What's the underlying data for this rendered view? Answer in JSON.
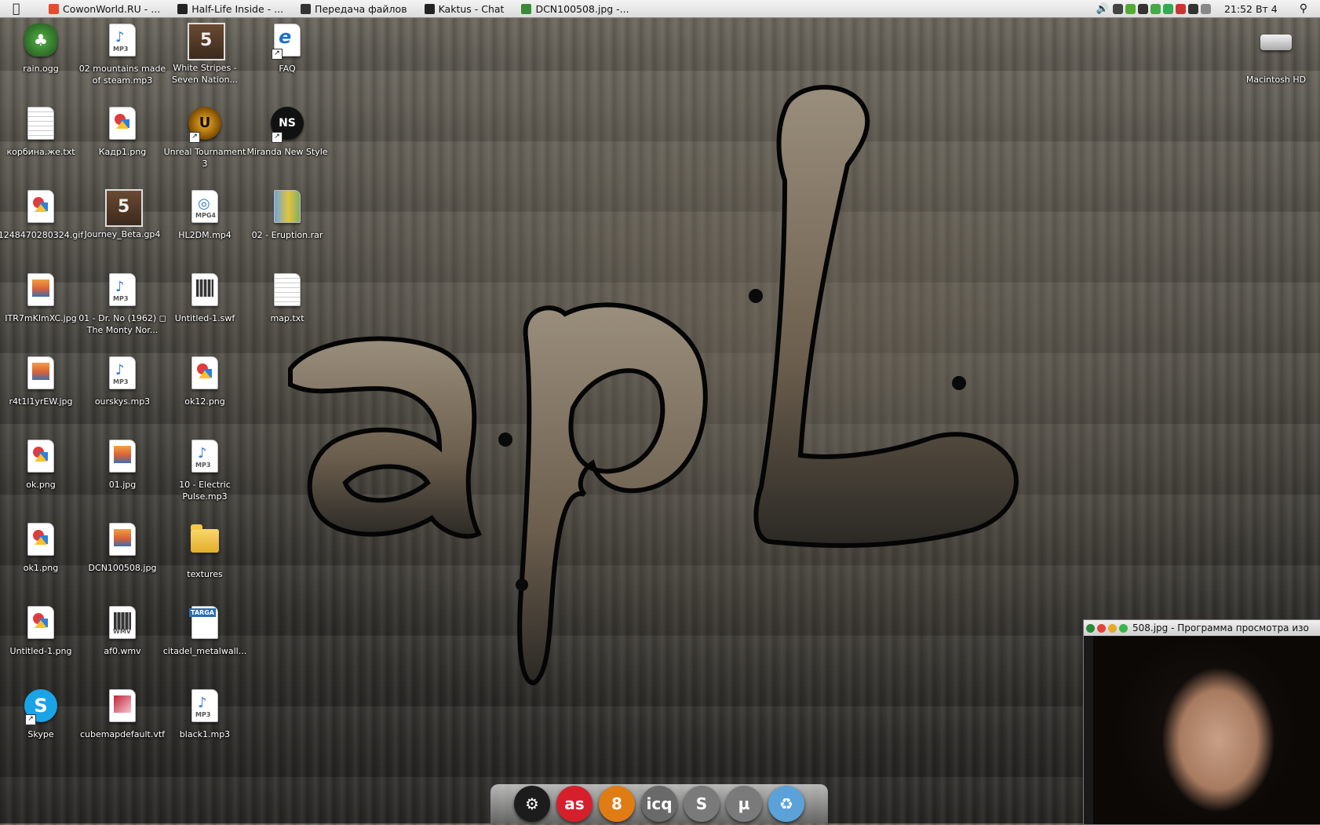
{
  "menubar": {
    "apple": "",
    "tasks": [
      {
        "label": "CowonWorld.RU - ...",
        "icon": "chrome-icon",
        "color": "#e44c30"
      },
      {
        "label": "Half-Life Inside - ...",
        "icon": "steam-window-icon",
        "color": "#222222"
      },
      {
        "label": "Передача файлов",
        "icon": "floppy-icon",
        "color": "#333333"
      },
      {
        "label": "Kaktus - Chat",
        "icon": "steam-window-icon",
        "color": "#222222"
      },
      {
        "label": "DCN100508.jpg -...",
        "icon": "image-viewer-icon",
        "color": "#3a8a3a"
      }
    ],
    "clock": "21:52 Вт 4",
    "tray_colors": [
      "#444444",
      "#55aa33",
      "#333333",
      "#44aa44",
      "#33aa55",
      "#cc3333",
      "#333333",
      "#888888"
    ]
  },
  "desktop": {
    "columns": [
      [
        {
          "label": "rain.ogg",
          "icon": "rain-ogg-icon"
        },
        {
          "label": "корбина.же.txt",
          "icon": "text-file-icon"
        },
        {
          "label": "1248470280324.gif",
          "icon": "image-file-icon"
        },
        {
          "label": "ITR7mKImXC.jpg",
          "icon": "jpeg-file-icon"
        },
        {
          "label": "r4t1l1yrEW.jpg",
          "icon": "jpeg-file-icon"
        },
        {
          "label": "ok.png",
          "icon": "image-file-icon"
        },
        {
          "label": "ok1.png",
          "icon": "image-file-icon"
        },
        {
          "label": "Untitled-1.png",
          "icon": "image-file-icon"
        },
        {
          "label": "Skype",
          "icon": "skype-icon"
        }
      ],
      [
        {
          "label": "02 mountains made of steam.mp3",
          "icon": "mp3-file-icon"
        },
        {
          "label": "Кадр1.png",
          "icon": "image-file-icon"
        },
        {
          "label": "Journey_Beta.gp4",
          "icon": "guitar-pro-file-icon"
        },
        {
          "label": "01 - Dr. No (1962) ◻ The Monty Nor...",
          "icon": "mp3-file-icon"
        },
        {
          "label": "ourskys.mp3",
          "icon": "mp3-file-icon"
        },
        {
          "label": "01.jpg",
          "icon": "jpeg-file-icon"
        },
        {
          "label": "DCN100508.jpg",
          "icon": "jpeg-file-icon"
        },
        {
          "label": "af0.wmv",
          "icon": "wmv-file-icon"
        },
        {
          "label": "cubemapdefault.vtf",
          "icon": "vtf-file-icon"
        }
      ],
      [
        {
          "label": "White Stripes - Seven Nation...",
          "icon": "guitar-pro-file-icon"
        },
        {
          "label": "Unreal Tournament 3",
          "icon": "unreal-tournament-icon"
        },
        {
          "label": "HL2DM.mp4",
          "icon": "mp4-file-icon"
        },
        {
          "label": "Untitled-1.swf",
          "icon": "swf-file-icon"
        },
        {
          "label": "ok12.png",
          "icon": "image-file-icon"
        },
        {
          "label": "10 - Electric Pulse.mp3",
          "icon": "mp3-file-icon"
        },
        {
          "label": "textures",
          "icon": "folder-icon"
        },
        {
          "label": "citadel_metalwall...",
          "icon": "targa-file-icon"
        },
        {
          "label": "black1.mp3",
          "icon": "mp3-file-icon"
        }
      ],
      [
        {
          "label": "FAQ",
          "icon": "internet-explorer-icon"
        },
        {
          "label": "Miranda New Style",
          "icon": "miranda-icon"
        },
        {
          "label": "02 - Eruption.rar",
          "icon": "rar-archive-icon"
        },
        {
          "label": "map.txt",
          "icon": "text-file-icon"
        }
      ]
    ],
    "drive": {
      "label": "Macintosh HD",
      "icon": "hard-drive-icon"
    }
  },
  "wallpaper": {
    "text": "apL"
  },
  "viewer": {
    "title": "508.jpg - Программа просмотра изо"
  },
  "dock": {
    "items": [
      {
        "glyph": "⚙",
        "icon": "steam-icon",
        "color": "#1c1c1c"
      },
      {
        "glyph": "as",
        "icon": "lastfm-icon",
        "color": "#d5202c"
      },
      {
        "glyph": "8",
        "icon": "fl-studio-icon",
        "color": "#e07c14"
      },
      {
        "glyph": "icq",
        "icon": "icq-icon",
        "color": "#6a6a6a"
      },
      {
        "glyph": "S",
        "icon": "skype-dock-icon",
        "color": "#7a7a7a"
      },
      {
        "glyph": "µ",
        "icon": "utorrent-icon",
        "color": "#7a7a7a"
      },
      {
        "glyph": "♻",
        "icon": "recycle-bin-icon",
        "color": "#5aa2d8"
      }
    ]
  }
}
